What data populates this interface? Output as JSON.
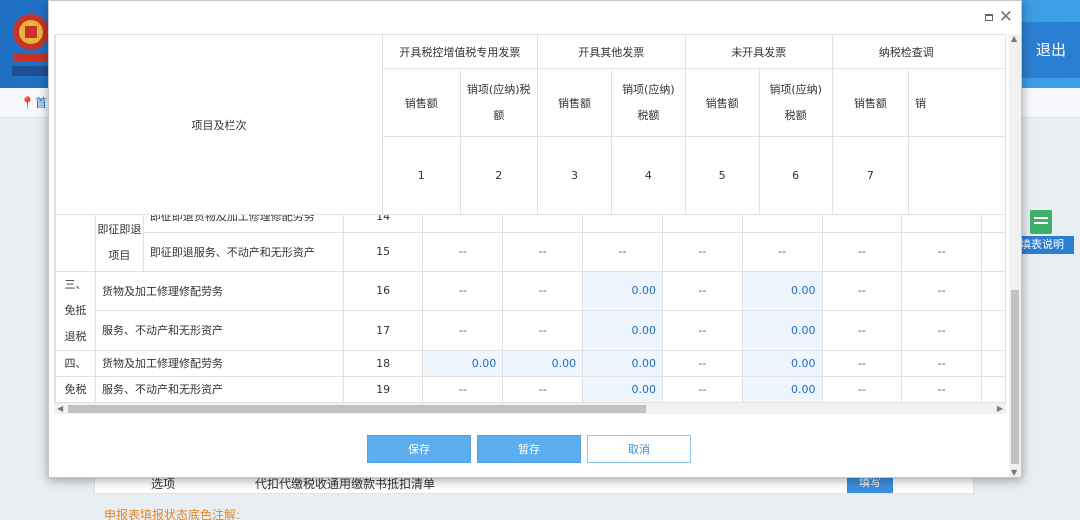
{
  "background": {
    "logout_label": "退出",
    "home_label": "首页",
    "help_label": "填表说明",
    "bottom_row_left": "选项",
    "bottom_row_text": "代扣代缴税收通用缴款书抵扣清单",
    "bottom_row_button": "填写",
    "legend_text": "申报表填报状态底色注解:"
  },
  "table": {
    "corner_label": "项目及栏次",
    "groups": [
      "开具税控增值税专用发票",
      "开具其他发票",
      "未开具发票",
      "纳税检查调"
    ],
    "subheaders": [
      "销售额",
      "销项(应纳)税额",
      "销售额",
      "销项(应纳)税额",
      "销售额",
      "销项(应纳)税额",
      "销售额",
      "销"
    ],
    "column_numbers": [
      "1",
      "2",
      "3",
      "4",
      "5",
      "6",
      "7",
      ""
    ],
    "partial_row": {
      "label": "即征即退货物及加工修理修配劳务",
      "line": "14"
    },
    "section_jizheng": "即征即退项目",
    "row15": {
      "label": "即征即退服务、不动产和无形资产",
      "line": "15",
      "cells": [
        "--",
        "--",
        "--",
        "--",
        "--",
        "--",
        "--",
        ""
      ]
    },
    "section3": "三、免抵退税",
    "row16": {
      "label": "货物及加工修理修配劳务",
      "line": "16",
      "cells": [
        "--",
        "--",
        "0.00",
        "--",
        "0.00",
        "--",
        "--",
        ""
      ]
    },
    "row17": {
      "label": "服务、不动产和无形资产",
      "line": "17",
      "cells": [
        "--",
        "--",
        "0.00",
        "--",
        "0.00",
        "--",
        "--",
        ""
      ]
    },
    "section4_a": "四、",
    "section4_b": "免税",
    "row18": {
      "label": "货物及加工修理修配劳务",
      "line": "18",
      "cells": [
        "0.00",
        "0.00",
        "0.00",
        "--",
        "0.00",
        "--",
        "--",
        ""
      ]
    },
    "row19": {
      "label": "服务、不动产和无形资产",
      "line": "19",
      "cells": [
        "--",
        "--",
        "0.00",
        "--",
        "0.00",
        "--",
        "--",
        ""
      ]
    }
  },
  "buttons": {
    "save": "保存",
    "draft": "暂存",
    "cancel": "取消"
  },
  "icons": {
    "close": "close-icon",
    "maximize": "maximize-icon",
    "home": "location-pin-icon",
    "help": "document-icon"
  },
  "colors": {
    "primary_button": "#5aaef0",
    "editable_cell": "#eef5fd",
    "value_text": "#1f6fc4",
    "header_bg": "#2f86d6"
  }
}
